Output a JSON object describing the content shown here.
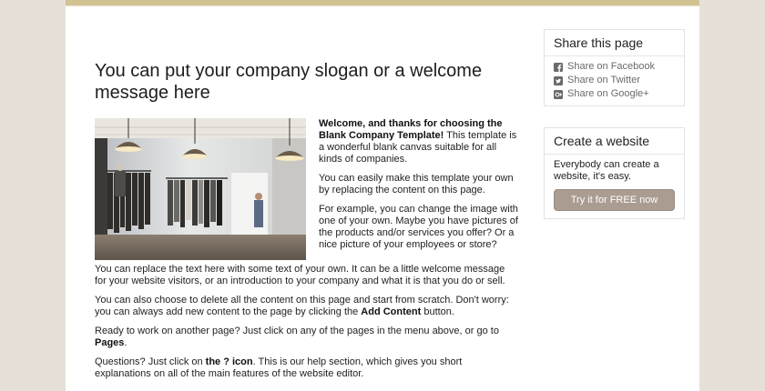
{
  "main": {
    "slogan": "You can put your company slogan or a welcome message here",
    "intro_bold": "Welcome, and thanks for choosing the Blank Company Template!",
    "intro_rest": " This template is a wonderful blank canvas suitable for all kinds of companies.",
    "p2": "You can easily make this template your own by replacing the content on this page.",
    "p3": "For example, you can change the image with one of your own. Maybe you have pictures of the products and/or services you offer? Or a nice picture of your employees or store?",
    "p4": "You can replace the text here with some text of your own. It can be a little welcome message for your website visitors, or an introduction to your company and what it is that you do or sell.",
    "p5_before": "You can also choose to delete all the content on this page and start from scratch. Don't worry: you can always add new content to the page by clicking the ",
    "p5_bold": "Add Content",
    "p5_after": " button.",
    "p6_before": "Ready to work on another page? Just click on any of the pages in the menu above, or go to ",
    "p6_bold": "Pages",
    "p6_after": ".",
    "p7_before": "Questions? Just click on ",
    "p7_bold": "the ? icon",
    "p7_after": ". This is our help section, which gives you short explanations on all of the main features of the website editor."
  },
  "share": {
    "title": "Share this page",
    "items": [
      {
        "label": "Share on Facebook",
        "icon": "facebook-icon"
      },
      {
        "label": "Share on Twitter",
        "icon": "twitter-icon"
      },
      {
        "label": "Share on Google+",
        "icon": "google-plus-icon"
      }
    ]
  },
  "create": {
    "title": "Create a website",
    "text": "Everybody can create a website, it's easy.",
    "button": "Try it for FREE now"
  },
  "colors": {
    "background": "#e6e0d6",
    "top_bar": "#d2c394",
    "button": "#ab9c91"
  }
}
